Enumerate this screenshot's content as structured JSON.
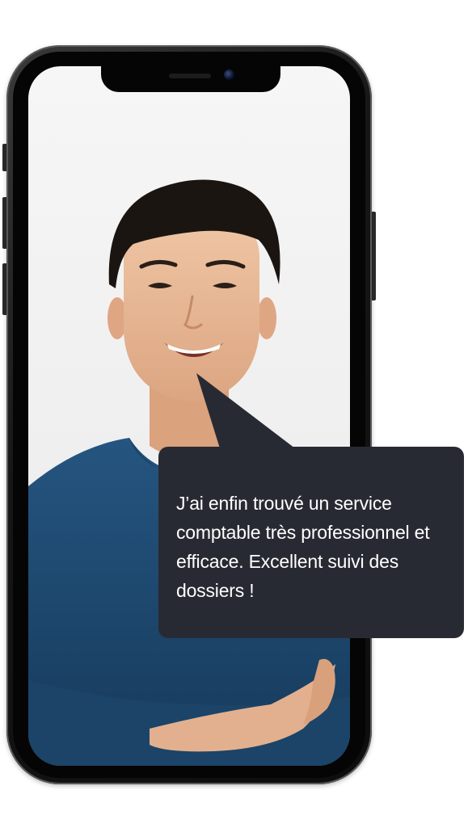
{
  "testimonial": {
    "quote": "J’ai enfin trouvé un service comptable très professionnel et efficace. Excellent suivi des dossiers !"
  },
  "colors": {
    "background": "#ffffff",
    "bubble": "#282a33",
    "bubble_text": "#ffffff",
    "shirt": "#1f4a6e",
    "phone_frame": "#111111"
  },
  "icons": [
    "smartphone-icon"
  ]
}
